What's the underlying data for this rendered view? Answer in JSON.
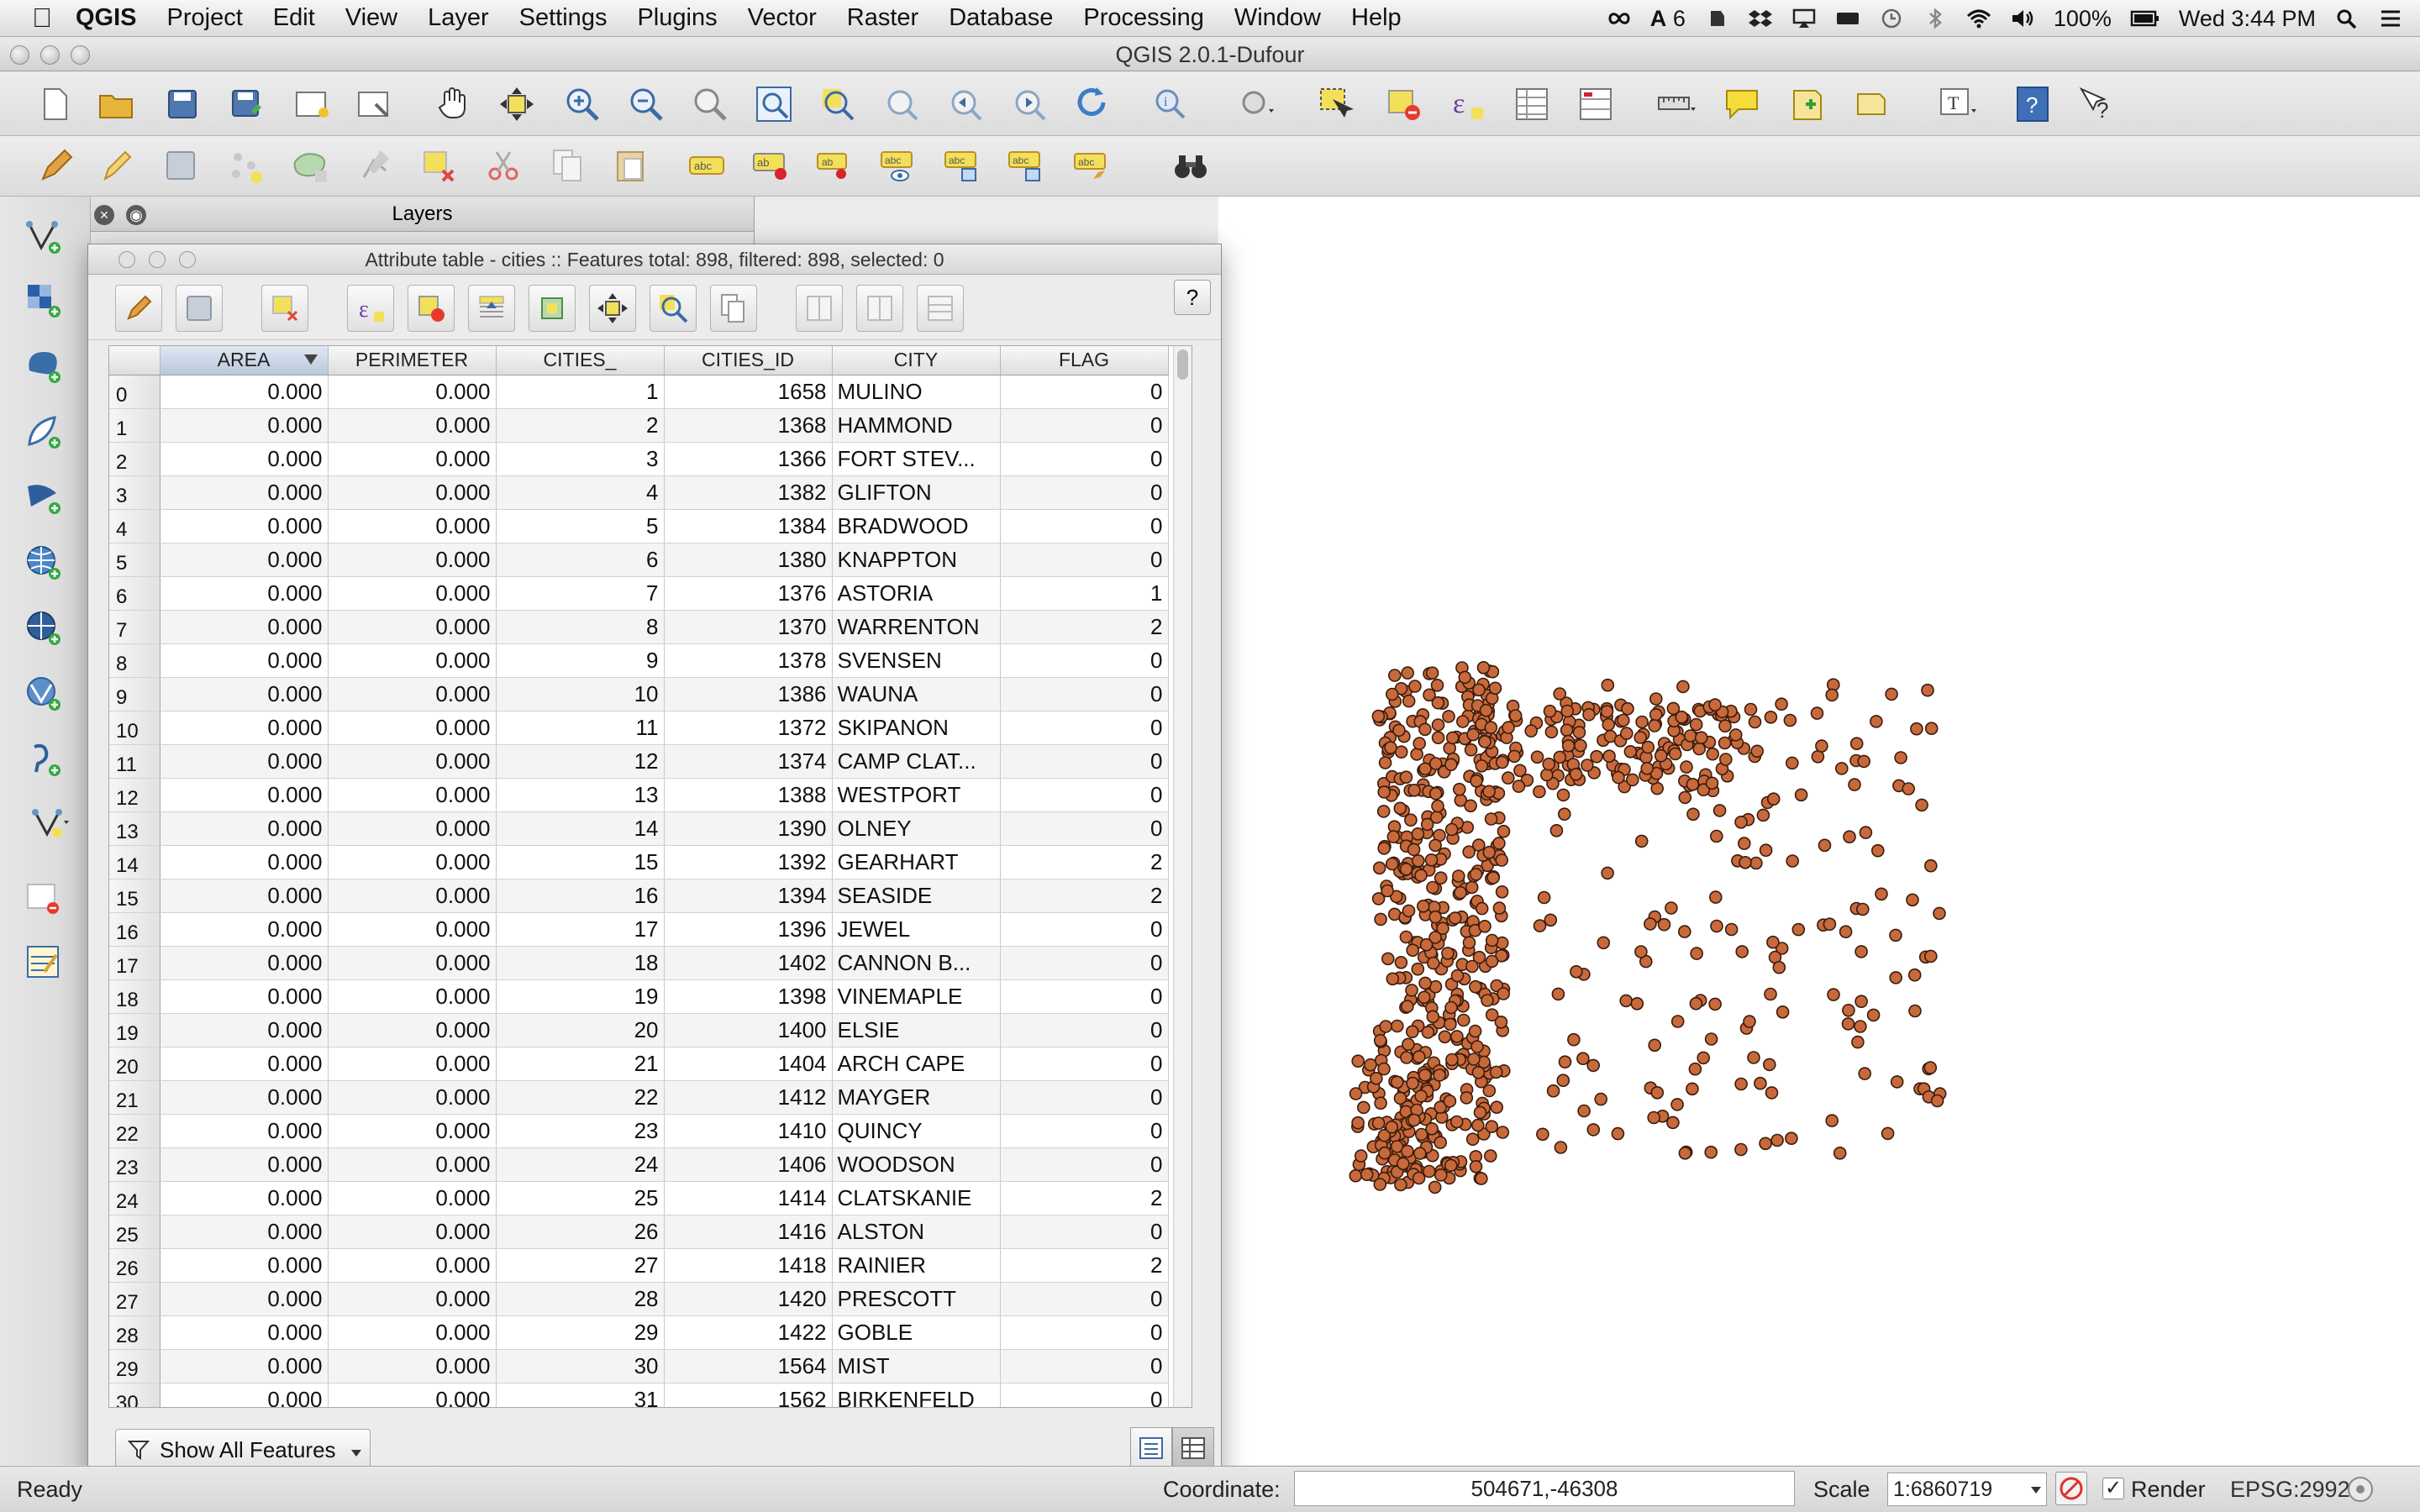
{
  "menubar": {
    "app_name": "QGIS",
    "items": [
      "Project",
      "Edit",
      "View",
      "Layer",
      "Settings",
      "Plugins",
      "Vector",
      "Raster",
      "Database",
      "Processing",
      "Window",
      "Help"
    ],
    "status_right": {
      "notification_count": "6",
      "battery": "100%",
      "clock": "Wed 3:44 PM"
    }
  },
  "window": {
    "title": "QGIS 2.0.1-Dufour"
  },
  "layers_panel": {
    "title": "Layers"
  },
  "attribute_table": {
    "title": "Attribute table - cities :: Features total: 898, filtered: 898, selected: 0",
    "columns": [
      "AREA",
      "PERIMETER",
      "CITIES_",
      "CITIES_ID",
      "CITY",
      "FLAG"
    ],
    "sorted_column": "AREA",
    "rows": [
      [
        "0",
        "0.000",
        "0.000",
        "1",
        "1658",
        "MULINO",
        "0"
      ],
      [
        "1",
        "0.000",
        "0.000",
        "2",
        "1368",
        "HAMMOND",
        "0"
      ],
      [
        "2",
        "0.000",
        "0.000",
        "3",
        "1366",
        "FORT STEV...",
        "0"
      ],
      [
        "3",
        "0.000",
        "0.000",
        "4",
        "1382",
        "GLIFTON",
        "0"
      ],
      [
        "4",
        "0.000",
        "0.000",
        "5",
        "1384",
        "BRADWOOD",
        "0"
      ],
      [
        "5",
        "0.000",
        "0.000",
        "6",
        "1380",
        "KNAPPTON",
        "0"
      ],
      [
        "6",
        "0.000",
        "0.000",
        "7",
        "1376",
        "ASTORIA",
        "1"
      ],
      [
        "7",
        "0.000",
        "0.000",
        "8",
        "1370",
        "WARRENTON",
        "2"
      ],
      [
        "8",
        "0.000",
        "0.000",
        "9",
        "1378",
        "SVENSEN",
        "0"
      ],
      [
        "9",
        "0.000",
        "0.000",
        "10",
        "1386",
        "WAUNA",
        "0"
      ],
      [
        "10",
        "0.000",
        "0.000",
        "11",
        "1372",
        "SKIPANON",
        "0"
      ],
      [
        "11",
        "0.000",
        "0.000",
        "12",
        "1374",
        "CAMP CLAT...",
        "0"
      ],
      [
        "12",
        "0.000",
        "0.000",
        "13",
        "1388",
        "WESTPORT",
        "0"
      ],
      [
        "13",
        "0.000",
        "0.000",
        "14",
        "1390",
        "OLNEY",
        "0"
      ],
      [
        "14",
        "0.000",
        "0.000",
        "15",
        "1392",
        "GEARHART",
        "2"
      ],
      [
        "15",
        "0.000",
        "0.000",
        "16",
        "1394",
        "SEASIDE",
        "2"
      ],
      [
        "16",
        "0.000",
        "0.000",
        "17",
        "1396",
        "JEWEL",
        "0"
      ],
      [
        "17",
        "0.000",
        "0.000",
        "18",
        "1402",
        "CANNON B...",
        "0"
      ],
      [
        "18",
        "0.000",
        "0.000",
        "19",
        "1398",
        "VINEMAPLE",
        "0"
      ],
      [
        "19",
        "0.000",
        "0.000",
        "20",
        "1400",
        "ELSIE",
        "0"
      ],
      [
        "20",
        "0.000",
        "0.000",
        "21",
        "1404",
        "ARCH CAPE",
        "0"
      ],
      [
        "21",
        "0.000",
        "0.000",
        "22",
        "1412",
        "MAYGER",
        "0"
      ],
      [
        "22",
        "0.000",
        "0.000",
        "23",
        "1410",
        "QUINCY",
        "0"
      ],
      [
        "23",
        "0.000",
        "0.000",
        "24",
        "1406",
        "WOODSON",
        "0"
      ],
      [
        "24",
        "0.000",
        "0.000",
        "25",
        "1414",
        "CLATSKANIE",
        "2"
      ],
      [
        "25",
        "0.000",
        "0.000",
        "26",
        "1416",
        "ALSTON",
        "0"
      ],
      [
        "26",
        "0.000",
        "0.000",
        "27",
        "1418",
        "RAINIER",
        "2"
      ],
      [
        "27",
        "0.000",
        "0.000",
        "28",
        "1420",
        "PRESCOTT",
        "0"
      ],
      [
        "28",
        "0.000",
        "0.000",
        "29",
        "1422",
        "GOBLE",
        "0"
      ],
      [
        "29",
        "0.000",
        "0.000",
        "30",
        "1564",
        "MIST",
        "0"
      ],
      [
        "30",
        "0.000",
        "0.000",
        "31",
        "1562",
        "BIRKENFELD",
        "0"
      ]
    ],
    "filter_button_label": "Show All Features",
    "help_label": "?"
  },
  "map": {
    "point_color": "#c8693c",
    "point_outline": "#3a1c0c"
  },
  "statusbar": {
    "ready": "Ready",
    "coordinate_label": "Coordinate:",
    "coordinate_value": "504671,-46308",
    "scale_label": "Scale",
    "scale_value": "1:6860719",
    "render_label": "Render",
    "crs": "EPSG:2992"
  },
  "icons": {
    "toolbar1": [
      "new-project-icon",
      "open-project-icon",
      "save-project-icon",
      "save-as-icon",
      "new-print-composer-icon",
      "composer-manager-icon",
      "pan-icon",
      "pan-to-selection-icon",
      "zoom-in-icon",
      "zoom-out-icon",
      "zoom-native-icon",
      "zoom-full-icon",
      "zoom-to-selection-icon",
      "zoom-to-layer-icon",
      "zoom-last-icon",
      "zoom-next-icon",
      "refresh-icon",
      "identify-icon",
      "select-by-location-icon",
      "select-features-icon",
      "deselect-icon",
      "field-calculator-icon",
      "attribute-table-icon",
      "statistics-icon",
      "measure-icon",
      "map-tips-icon",
      "new-bookmark-icon",
      "show-bookmarks-icon",
      "text-annotation-icon",
      "help-icon",
      "whats-this-icon"
    ],
    "toolbar2": [
      "toggle-editing-icon",
      "current-edits-icon",
      "save-edits-icon",
      "add-feature-icon",
      "move-feature-icon",
      "node-tool-icon",
      "delete-selected-icon",
      "cut-features-icon",
      "copy-features-icon",
      "paste-features-icon",
      "label-icon",
      "pin-label-icon",
      "show-hide-labels-icon",
      "move-label-icon",
      "rotate-label-icon",
      "change-label-icon",
      "label-props-icon",
      "gps-binoculars-icon"
    ]
  }
}
